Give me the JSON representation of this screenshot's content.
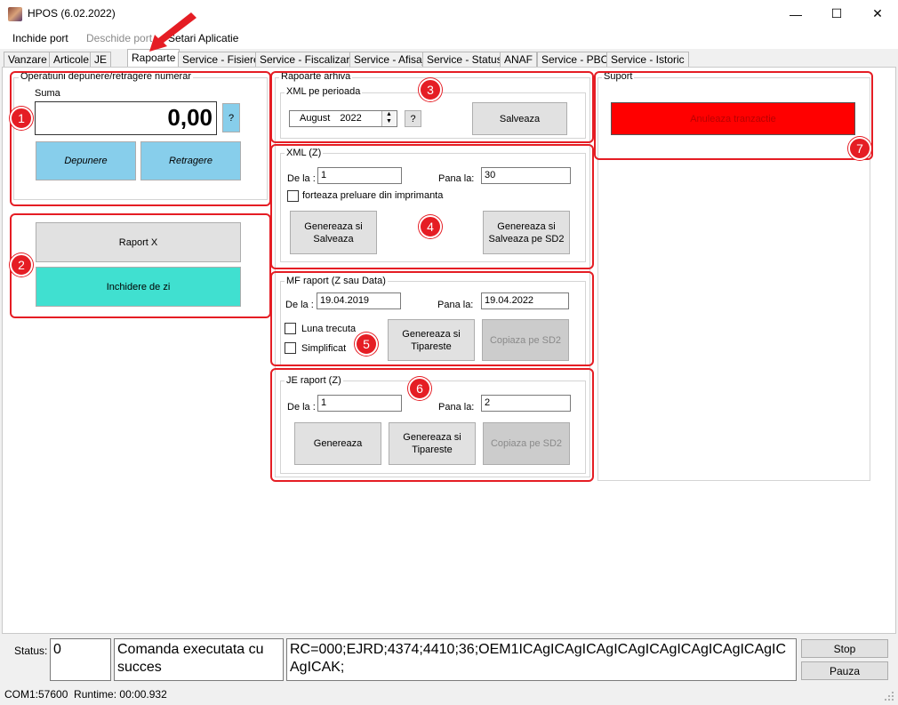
{
  "window": {
    "title": "HPOS (6.02.2022)",
    "minimize_glyph": "—",
    "maximize_glyph": "☐",
    "close_glyph": "✕"
  },
  "menu": {
    "items": [
      "Inchide port",
      "Deschide port",
      "Setari Aplicatie"
    ]
  },
  "tabs": [
    "Vanzare",
    "Articole",
    "JE",
    "Rapoarte",
    "Service - Fisiere",
    "Service - Fiscalizare",
    "Service - Afisaj",
    "Service - Status",
    "ANAF",
    "Service - PBC",
    "Service - Istoric"
  ],
  "active_tab": "Rapoarte",
  "cash_ops": {
    "legend": "Operatiuni depunere/retragere numerar",
    "suma_label": "Suma",
    "amount": "0,00",
    "help": "?",
    "deposit": "Depunere",
    "withdraw": "Retragere"
  },
  "reports": {
    "raport_x": "Raport X",
    "inchidere": "Inchidere de zi"
  },
  "archive": {
    "legend": "Rapoarte arhiva",
    "xml_period": {
      "legend": "XML pe perioada",
      "month": "August",
      "year": "2022",
      "help": "?",
      "save": "Salveaza"
    },
    "xml_z": {
      "legend": "XML (Z)",
      "from_label": "De la :",
      "from_value": "1",
      "to_label": "Pana la:",
      "to_value": "30",
      "force_label": "forteaza preluare din imprimanta",
      "gen_save": "Genereaza si Salveaza",
      "gen_save_sd2": "Genereaza si Salveaza pe SD2"
    },
    "mf": {
      "legend": "MF raport (Z sau Data)",
      "from_label": "De la :",
      "from_value": "19.04.2019",
      "to_label": "Pana la:",
      "to_value": "19.04.2022",
      "last_month": "Luna trecuta",
      "simplified": "Simplificat",
      "gen_print": "Genereaza si Tipareste",
      "copy_sd2": "Copiaza pe SD2"
    },
    "je": {
      "legend": "JE raport (Z)",
      "from_label": "De la :",
      "from_value": "1",
      "to_label": "Pana la:",
      "to_value": "2",
      "gen": "Genereaza",
      "gen_print": "Genereaza si Tipareste",
      "copy_sd2": "Copiaza pe SD2"
    }
  },
  "support": {
    "legend": "Suport",
    "cancel": "Anuleaza tranzactie"
  },
  "badges": [
    "1",
    "2",
    "3",
    "4",
    "5",
    "6",
    "7"
  ],
  "status": {
    "label": "Status:",
    "code": "0",
    "message": "Comanda executata cu succes",
    "response": "RC=000;EJRD;4374;4410;36;OEM1ICAgICAgICAgICAgICAgICAgICAgICAgICAgICAK;",
    "stop": "Stop",
    "pause": "Pauza"
  },
  "footer": {
    "text": "COM1:57600  Runtime: 00:00.932"
  },
  "colors": {
    "highlight": "#e51d24",
    "deposit": "#87ceeb",
    "close_day": "#40e0d0",
    "cancel": "#ff0000"
  }
}
